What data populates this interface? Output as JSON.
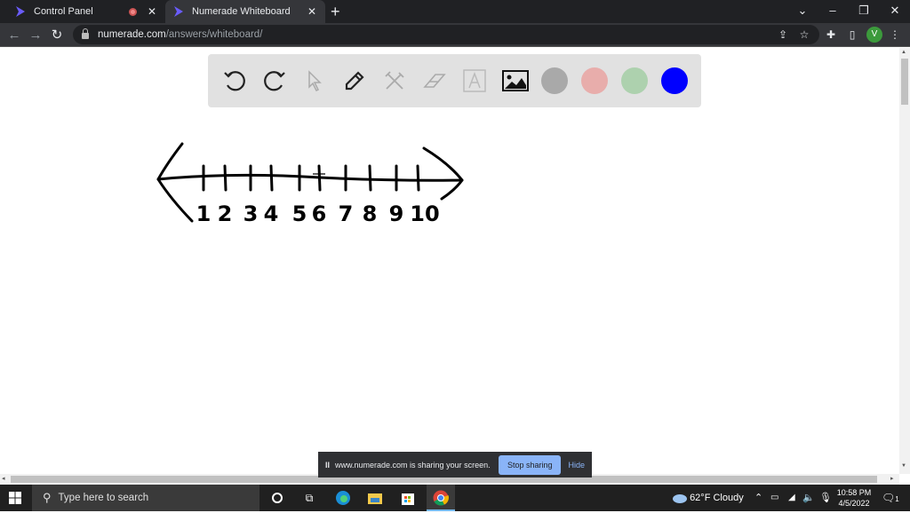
{
  "browser": {
    "tabs": [
      {
        "title": "Control Panel",
        "active": false,
        "recording": true
      },
      {
        "title": "Numerade Whiteboard",
        "active": true,
        "recording": false
      }
    ],
    "new_tab_label": "+",
    "url_host": "numerade.com",
    "url_path": "/answers/whiteboard/",
    "profile_initial": "V"
  },
  "whiteboard": {
    "tools": [
      {
        "name": "undo",
        "enabled": true
      },
      {
        "name": "redo",
        "enabled": true
      },
      {
        "name": "select",
        "enabled": false
      },
      {
        "name": "pen",
        "enabled": true
      },
      {
        "name": "tools",
        "enabled": false
      },
      {
        "name": "eraser",
        "enabled": false
      },
      {
        "name": "text",
        "enabled": false
      },
      {
        "name": "image",
        "enabled": true
      }
    ],
    "colors": [
      {
        "name": "gray",
        "hex": "#a9a9a9"
      },
      {
        "name": "pink",
        "hex": "#e8adab"
      },
      {
        "name": "green",
        "hex": "#add1ae"
      },
      {
        "name": "blue",
        "hex": "#0000ff",
        "selected": true
      }
    ],
    "drawing": {
      "description": "Hand-drawn number line with arrows on both ends",
      "tick_labels": [
        "1",
        "2",
        "3",
        "4",
        "5",
        "6",
        "7",
        "8",
        "9",
        "10"
      ]
    }
  },
  "share_bar": {
    "pause_icon": "II",
    "message": "www.numerade.com is sharing your screen.",
    "stop_label": "Stop sharing",
    "hide_label": "Hide"
  },
  "taskbar": {
    "search_placeholder": "Type here to search",
    "weather_temp": "62°F",
    "weather_desc": "Cloudy",
    "time": "10:58 PM",
    "date": "4/5/2022",
    "notification_count": "1"
  }
}
